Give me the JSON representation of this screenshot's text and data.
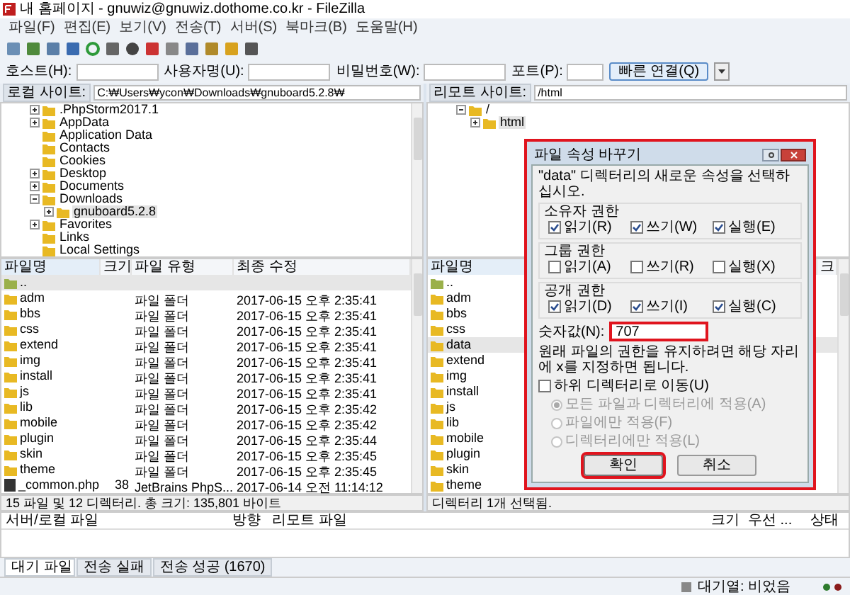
{
  "window": {
    "title": "내 홈페이지 - gnuwiz@gnuwiz.dothome.co.kr - FileZilla"
  },
  "menu": [
    "파일(F)",
    "편집(E)",
    "보기(V)",
    "전송(T)",
    "서버(S)",
    "북마크(B)",
    "도움말(H)"
  ],
  "quick_connect": {
    "fields": [
      {
        "label": "호스트(H):"
      },
      {
        "label": "사용자명(U):"
      },
      {
        "label": "비밀번호(W):"
      },
      {
        "label": "포트(P):"
      }
    ],
    "button": "빠른 연결(Q)"
  },
  "local": {
    "site_label": "로컬 사이트:",
    "path": "C:₩Users₩ycon₩Downloads₩gnuboard5.2.8₩",
    "tree": [
      {
        "name": ".PhpStorm2017.1",
        "expanded": false,
        "selected": false
      },
      {
        "name": "AppData",
        "expanded": false,
        "selected": false
      },
      {
        "name": "Application Data",
        "selected": false
      },
      {
        "name": "Contacts",
        "selected": false
      },
      {
        "name": "Cookies",
        "selected": false
      },
      {
        "name": "Desktop",
        "expanded": false,
        "selected": false
      },
      {
        "name": "Documents",
        "expanded": false,
        "selected": false
      },
      {
        "name": "Downloads",
        "expanded": true,
        "selected": false,
        "children": [
          {
            "name": "gnuboard5.2.8",
            "expanded": false,
            "selected": true
          }
        ]
      },
      {
        "name": "Favorites",
        "expanded": false,
        "selected": false
      },
      {
        "name": "Links",
        "selected": false
      },
      {
        "name": "Local Settings",
        "selected": false
      }
    ],
    "columns": [
      "파일명",
      "크기",
      "파일 유형",
      "최종 수정"
    ],
    "files": [
      {
        "kind": "up",
        "name": "..",
        "selected": true
      },
      {
        "kind": "folder",
        "name": "adm",
        "type": "파일 폴더",
        "modified": "2017-06-15 오후 2:35:41",
        "selected": false
      },
      {
        "kind": "folder",
        "name": "bbs",
        "type": "파일 폴더",
        "modified": "2017-06-15 오후 2:35:41",
        "selected": false
      },
      {
        "kind": "folder",
        "name": "css",
        "type": "파일 폴더",
        "modified": "2017-06-15 오후 2:35:41",
        "selected": false
      },
      {
        "kind": "folder",
        "name": "extend",
        "type": "파일 폴더",
        "modified": "2017-06-15 오후 2:35:41",
        "selected": false
      },
      {
        "kind": "folder",
        "name": "img",
        "type": "파일 폴더",
        "modified": "2017-06-15 오후 2:35:41",
        "selected": false
      },
      {
        "kind": "folder",
        "name": "install",
        "type": "파일 폴더",
        "modified": "2017-06-15 오후 2:35:41",
        "selected": false
      },
      {
        "kind": "folder",
        "name": "js",
        "type": "파일 폴더",
        "modified": "2017-06-15 오후 2:35:41",
        "selected": false
      },
      {
        "kind": "folder",
        "name": "lib",
        "type": "파일 폴더",
        "modified": "2017-06-15 오후 2:35:42",
        "selected": false
      },
      {
        "kind": "folder",
        "name": "mobile",
        "type": "파일 폴더",
        "modified": "2017-06-15 오후 2:35:42",
        "selected": false
      },
      {
        "kind": "folder",
        "name": "plugin",
        "type": "파일 폴더",
        "modified": "2017-06-15 오후 2:35:44",
        "selected": false
      },
      {
        "kind": "folder",
        "name": "skin",
        "type": "파일 폴더",
        "modified": "2017-06-15 오후 2:35:45",
        "selected": false
      },
      {
        "kind": "folder",
        "name": "theme",
        "type": "파일 폴더",
        "modified": "2017-06-15 오후 2:35:45",
        "selected": false
      },
      {
        "kind": "file",
        "name": "_common.php",
        "size": "38",
        "type": "JetBrains PhpS...",
        "modified": "2017-06-14 오전 11:14:12",
        "selected": false
      }
    ],
    "status": "15 파일 및 12 디렉터리. 총 크기: 135,801 바이트"
  },
  "remote": {
    "site_label": "리모트 사이트:",
    "path": "/html",
    "tree": [
      {
        "name": "/",
        "expanded": true,
        "selected": false,
        "children": [
          {
            "name": "html",
            "expanded": false,
            "selected": true
          }
        ]
      }
    ],
    "columns": [
      "파일명",
      "크"
    ],
    "files": [
      {
        "kind": "up",
        "name": "..",
        "selected": false
      },
      {
        "kind": "folder",
        "name": "adm",
        "selected": false
      },
      {
        "kind": "folder",
        "name": "bbs",
        "selected": false
      },
      {
        "kind": "folder",
        "name": "css",
        "selected": false
      },
      {
        "kind": "folder",
        "name": "data",
        "selected": true
      },
      {
        "kind": "folder",
        "name": "extend",
        "selected": false
      },
      {
        "kind": "folder",
        "name": "img",
        "selected": false
      },
      {
        "kind": "folder",
        "name": "install",
        "selected": false
      },
      {
        "kind": "folder",
        "name": "js",
        "selected": false
      },
      {
        "kind": "folder",
        "name": "lib",
        "selected": false
      },
      {
        "kind": "folder",
        "name": "mobile",
        "selected": false
      },
      {
        "kind": "folder",
        "name": "plugin",
        "selected": false
      },
      {
        "kind": "folder",
        "name": "skin",
        "selected": false
      },
      {
        "kind": "folder",
        "name": "theme",
        "selected": false
      }
    ],
    "status": "디렉터리 1개 선택됨."
  },
  "dialog": {
    "title": "파일 속성 바꾸기",
    "highlighted": true,
    "description": "\"data\" 디렉터리의 새로운 속성을 선택하십시오.",
    "groups": [
      {
        "label": "소유자 권한",
        "options": [
          {
            "label": "읽기(R)",
            "checked": true
          },
          {
            "label": "쓰기(W)",
            "checked": true
          },
          {
            "label": "실행(E)",
            "checked": true
          }
        ]
      },
      {
        "label": "그룹 권한",
        "options": [
          {
            "label": "읽기(A)",
            "checked": false
          },
          {
            "label": "쓰기(R)",
            "checked": false
          },
          {
            "label": "실행(X)",
            "checked": false
          }
        ]
      },
      {
        "label": "공개 권한",
        "options": [
          {
            "label": "읽기(D)",
            "checked": true
          },
          {
            "label": "쓰기(I)",
            "checked": true
          },
          {
            "label": "실행(C)",
            "checked": true
          }
        ]
      }
    ],
    "numeric": {
      "label": "숫자값(N):",
      "value": "707",
      "highlighted": true
    },
    "note": "원래 파일의 권한을 유지하려면 해당 자리에 x를 지정하면 됩니다.",
    "recurse": {
      "label": "하위 디렉터리로 이동(U)",
      "checked": false
    },
    "apply_options": [
      {
        "label": "모든 파일과 디렉터리에 적용(A)",
        "selected": true,
        "disabled": true
      },
      {
        "label": "파일에만 적용(F)",
        "selected": false,
        "disabled": true
      },
      {
        "label": "디렉터리에만 적용(L)",
        "selected": false,
        "disabled": true
      }
    ],
    "buttons": [
      {
        "label": "확인",
        "highlighted": true
      },
      {
        "label": "취소",
        "highlighted": false
      }
    ]
  },
  "queue": {
    "columns": [
      "서버/로컬 파일",
      "방향",
      "리모트 파일",
      "크기",
      "우선 ...",
      "상태"
    ]
  },
  "tabs": [
    {
      "label": "대기 파일",
      "selected": true
    },
    {
      "label": "전송 실패",
      "selected": false
    },
    {
      "label": "전송 성공 (1670)",
      "selected": false
    }
  ],
  "status_bar": {
    "queue": "대기열: 비었음"
  }
}
